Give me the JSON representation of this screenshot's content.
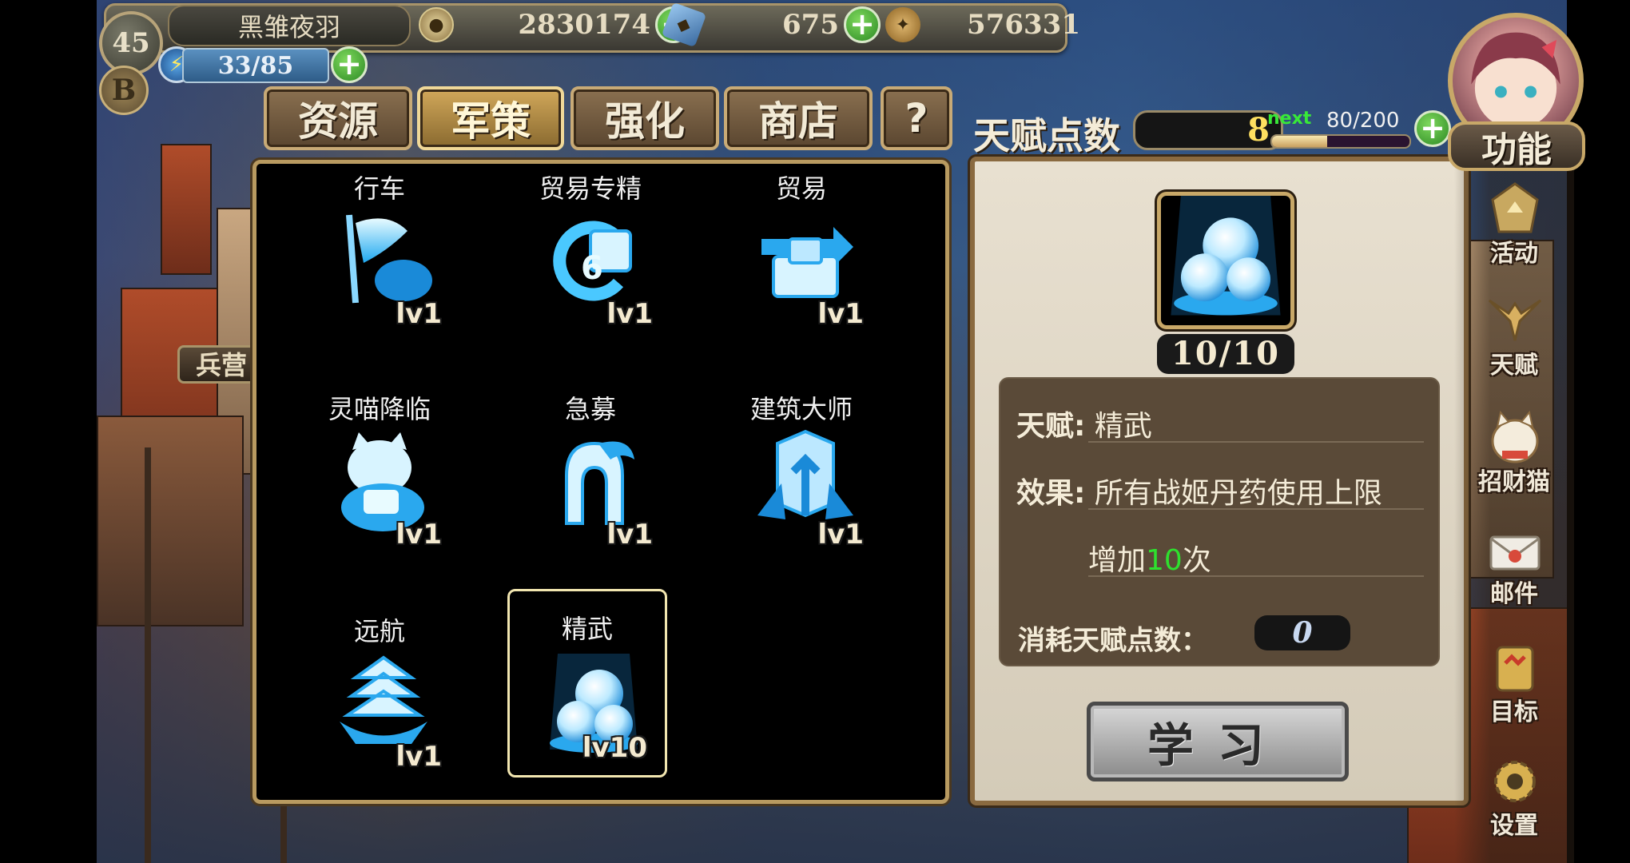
{
  "player": {
    "level": "45",
    "name": "黑雏夜羽",
    "badge_letter": "B",
    "energy": "33/85"
  },
  "resources": [
    {
      "name": "coin",
      "value": "2830174",
      "color": "#c8b070"
    },
    {
      "name": "gem",
      "value": "675",
      "color": "#6a9ac8"
    },
    {
      "name": "feather",
      "value": "576331",
      "color": "#b89050"
    }
  ],
  "tabs": [
    {
      "label": "资源",
      "active": false
    },
    {
      "label": "军策",
      "active": true
    },
    {
      "label": "强化",
      "active": false
    },
    {
      "label": "商店",
      "active": false
    },
    {
      "label": "?",
      "active": false
    }
  ],
  "talent": {
    "label": "天赋点数",
    "points": "8",
    "next_label": "next",
    "next_value": "80/200",
    "next_progress": 0.4
  },
  "skills": [
    {
      "title": "行车",
      "level": "lv1",
      "icon": "flag-icon"
    },
    {
      "title": "贸易专精",
      "level": "lv1",
      "icon": "trade-cycle-icon"
    },
    {
      "title": "贸易",
      "level": "lv1",
      "icon": "cargo-icon"
    },
    {
      "title": "灵喵降临",
      "level": "lv1",
      "icon": "lucky-cat-icon"
    },
    {
      "title": "急募",
      "level": "lv1",
      "icon": "helmet-icon"
    },
    {
      "title": "建筑大师",
      "level": "lv1",
      "icon": "building-icon"
    },
    {
      "title": "远航",
      "level": "lv1",
      "icon": "ship-icon"
    },
    {
      "title": "精武",
      "level": "lv10",
      "icon": "pearls-icon",
      "selected": true
    }
  ],
  "detail": {
    "count": "10/10",
    "talent_key": "天赋:",
    "talent_name": "精武",
    "effect_key": "效果:",
    "effect_line1": "所有战姬丹药使用上限",
    "effect_line2_pre": "增加",
    "effect_line2_num": "10",
    "effect_line2_post": "次",
    "cost_label": "消耗天赋点数：",
    "cost_value": "0",
    "learn_button": "学习",
    "highlight_color": "#2ee02e"
  },
  "side_menu": {
    "func_label": "功能",
    "items": [
      {
        "label": "活动",
        "icon": "activity-icon"
      },
      {
        "label": "天赋",
        "icon": "talent-icon"
      },
      {
        "label": "招财猫",
        "icon": "lucky-cat-icon"
      },
      {
        "label": "邮件",
        "icon": "mail-icon"
      },
      {
        "label": "目标",
        "icon": "target-icon"
      },
      {
        "label": "设置",
        "icon": "settings-icon"
      }
    ]
  },
  "background": {
    "barracks_label": "兵营"
  }
}
